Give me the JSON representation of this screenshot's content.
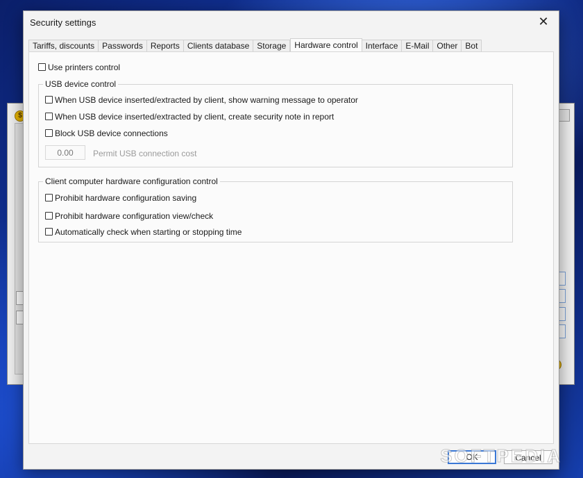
{
  "background_app": {
    "coin_symbol": "$"
  },
  "dialog": {
    "title": "Security settings",
    "close_symbol": "✕",
    "tabs": [
      {
        "label": "Tariffs, discounts",
        "active": false
      },
      {
        "label": "Passwords",
        "active": false
      },
      {
        "label": "Reports",
        "active": false
      },
      {
        "label": "Clients database",
        "active": false
      },
      {
        "label": "Storage",
        "active": false
      },
      {
        "label": "Hardware control",
        "active": true
      },
      {
        "label": "Interface",
        "active": false
      },
      {
        "label": "E-Mail",
        "active": false
      },
      {
        "label": "Other",
        "active": false
      },
      {
        "label": "Bot",
        "active": false
      }
    ],
    "use_printers_control": {
      "label": "Use printers control",
      "checked": false
    },
    "usb_group": {
      "legend": "USB device control",
      "options": [
        {
          "label": "When USB device inserted/extracted by client, show warning message to operator",
          "checked": false
        },
        {
          "label": "When USB device inserted/extracted by client, create security note in report",
          "checked": false
        },
        {
          "label": "Block USB device connections",
          "checked": false
        }
      ],
      "cost_value": "0.00",
      "cost_label": "Permit USB connection cost"
    },
    "hardware_group": {
      "legend": "Client computer hardware configuration control",
      "options": [
        {
          "label": "Prohibit hardware configuration saving",
          "checked": false
        },
        {
          "label": "Prohibit hardware configuration view/check",
          "checked": false
        },
        {
          "label": "Automatically check when starting or stopping time",
          "checked": false
        }
      ]
    },
    "ok_label": "OK",
    "cancel_label": "Cancel"
  },
  "watermark": "SOFTPEDIA"
}
